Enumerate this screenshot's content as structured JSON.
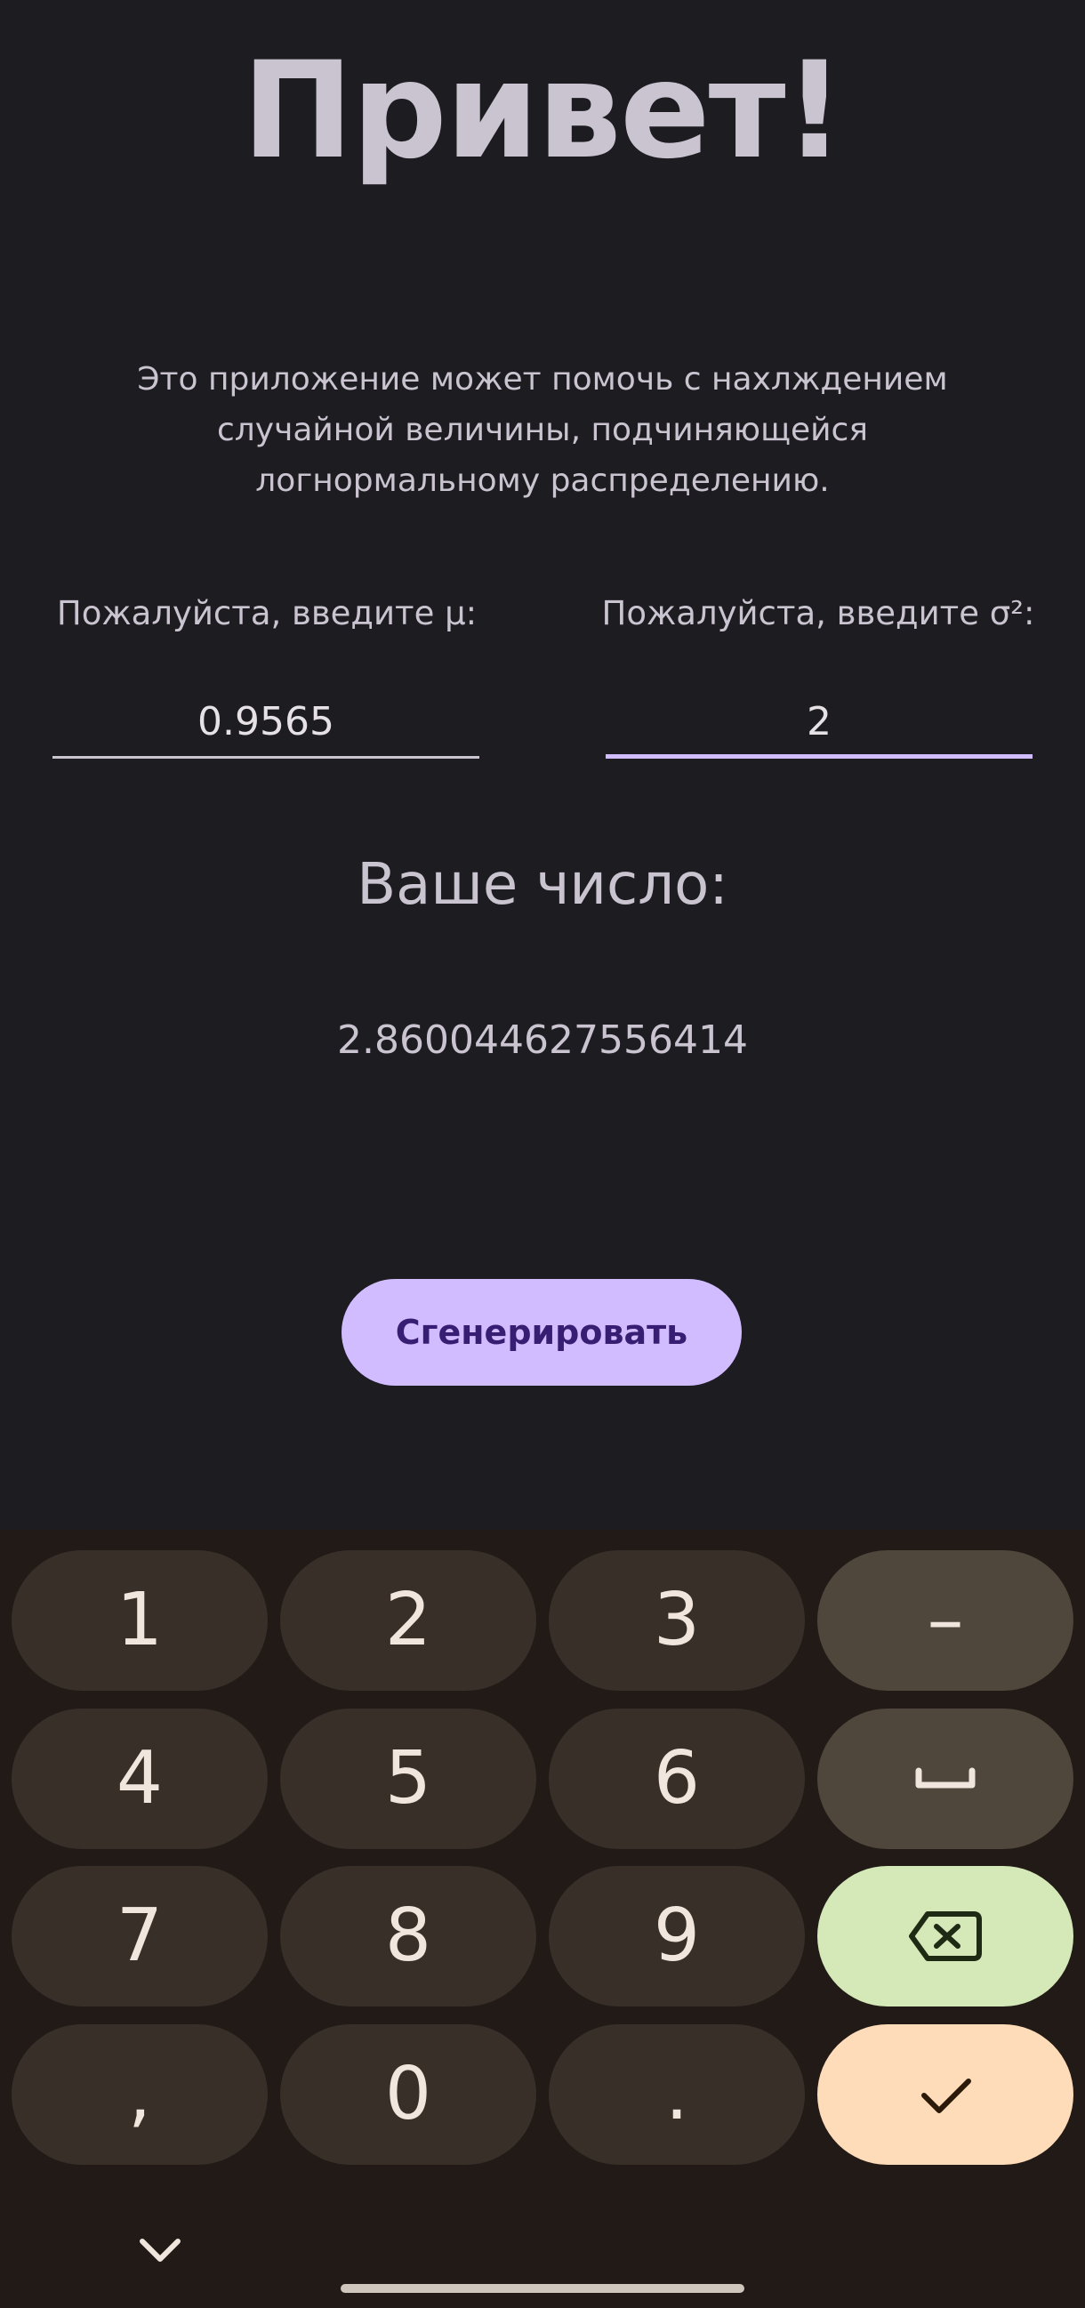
{
  "app": {
    "title": "Привет!",
    "description": "Это приложение может помочь с нахлждением случайной величины, подчиняющейся логнормальному распределению.",
    "mu_label": "Пожалуйста, введите μ:",
    "mu_value": "0.9565",
    "sigma_label": "Пожалуйста, введите σ²:",
    "sigma_value": "2",
    "result_heading": "Ваше число:",
    "result_value": "2.860044627556414",
    "generate_label": "Сгенерировать"
  },
  "keyboard": {
    "keys": {
      "k1": "1",
      "k2": "2",
      "k3": "3",
      "minus": "–",
      "k4": "4",
      "k5": "5",
      "k6": "6",
      "k7": "7",
      "k8": "8",
      "k9": "9",
      "comma": ",",
      "k0": "0",
      "period": "."
    },
    "icons": {
      "space": "space-bar-icon",
      "backspace": "backspace-icon",
      "done": "checkmark-icon",
      "collapse": "chevron-down-icon"
    }
  },
  "colors": {
    "background": "#1d1c21",
    "accent": "#d0bcff",
    "button_text": "#381e72",
    "keyboard_bg": "#211a16",
    "key_bg": "#382f29",
    "fn_key_bg": "#4f463c",
    "backspace_key_bg": "#d4e8b8",
    "done_key_bg": "#ffdcb9"
  }
}
